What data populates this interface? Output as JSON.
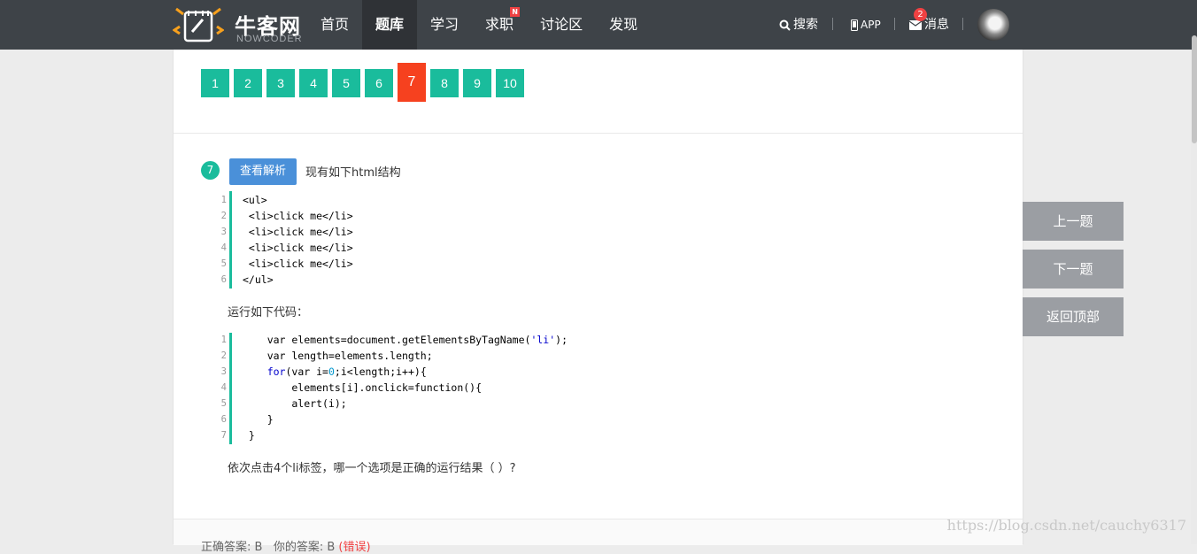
{
  "header": {
    "logo_cn": "牛客网",
    "logo_en": "NOWCODER",
    "nav": [
      "首页",
      "题库",
      "学习",
      "求职",
      "讨论区",
      "发现"
    ],
    "nav_new_tag": "N",
    "search": "搜索",
    "app": "APP",
    "message": "消息",
    "message_count": "2"
  },
  "pager": [
    "1",
    "2",
    "3",
    "4",
    "5",
    "6",
    "7",
    "8",
    "9",
    "10"
  ],
  "question": {
    "number": "7",
    "analysis_button": "查看解析",
    "title": "现有如下html结构",
    "html_lines": [
      "<ul>",
      " <li>click me</li>",
      " <li>click me</li>",
      " <li>click me</li>",
      " <li>click me</li>",
      "</ul>"
    ],
    "run_label": "运行如下代码：",
    "js_lines": [
      "    var elements=document.getElementsByTagName('li');",
      "    var length=elements.length;",
      "    for(var i=0;i<length;i++){",
      "        elements[i].onclick=function(){",
      "        alert(i);",
      "    }",
      " }"
    ],
    "prompt": "依次点击4个li标签，哪一个选项是正确的运行结果（ ）?"
  },
  "answer_strip": {
    "correct": "正确答案: B",
    "yours": "你的答案: B",
    "status": "(错误)"
  },
  "side": {
    "prev": "上一题",
    "next": "下一题",
    "top": "返回顶部"
  },
  "watermark": "https://blog.csdn.net/cauchy6317",
  "colors": {
    "topbar": "#3e4348",
    "accent": "#1abc9c",
    "current_page": "#f6411f",
    "analysis_button": "#4a90d9",
    "side_button": "#9b9ea3"
  }
}
